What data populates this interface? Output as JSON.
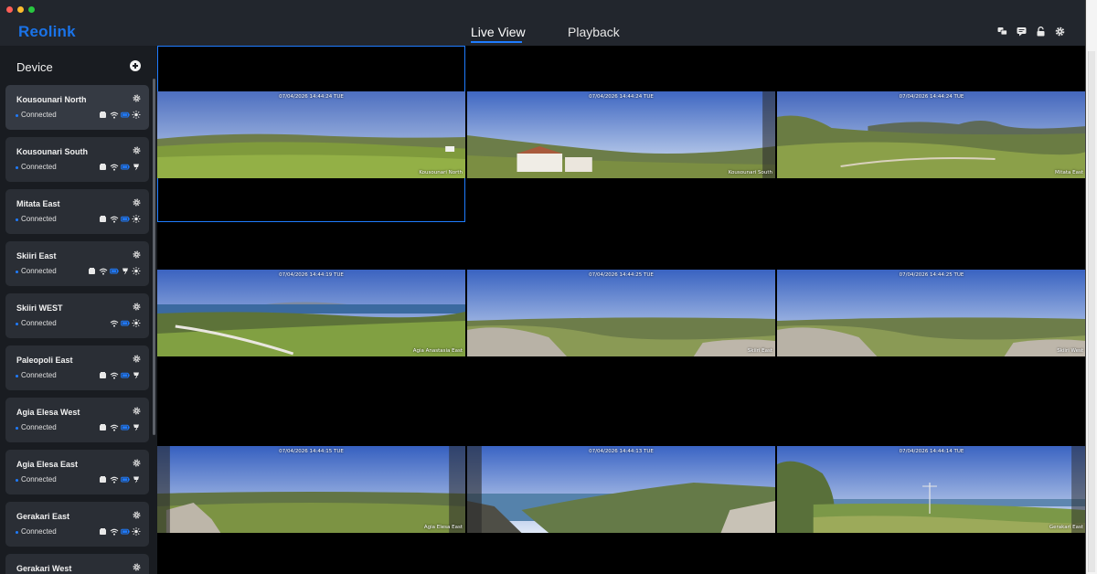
{
  "app": {
    "logo": "Reolink",
    "tabs": [
      {
        "label": "Live View",
        "active": true
      },
      {
        "label": "Playback",
        "active": false
      }
    ],
    "header_icons": [
      "messages-icon",
      "chat-icon",
      "lock-icon",
      "gear-icon"
    ],
    "accent_color": "#1f7cff"
  },
  "sidebar": {
    "title": "Device",
    "add_icon": "add-circle-icon",
    "devices": [
      {
        "name": "Kousounari North",
        "status": "Connected",
        "icons": [
          "storage-icon",
          "wifi-icon",
          "battery-icon",
          "sun-icon"
        ]
      },
      {
        "name": "Kousounari South",
        "status": "Connected",
        "icons": [
          "storage-icon",
          "wifi-icon",
          "battery-icon",
          "solar-charging-icon"
        ]
      },
      {
        "name": "Mitata East",
        "status": "Connected",
        "icons": [
          "storage-icon",
          "wifi-icon",
          "battery-icon",
          "sun-icon"
        ]
      },
      {
        "name": "Skiiri East",
        "status": "Connected",
        "icons": [
          "storage-icon",
          "wifi-icon",
          "battery-icon",
          "solar-charging-icon",
          "sun-icon"
        ]
      },
      {
        "name": "Skiiri WEST",
        "status": "Connected",
        "icons": [
          "wifi-icon",
          "battery-icon",
          "sun-icon"
        ]
      },
      {
        "name": "Paleopoli East",
        "status": "Connected",
        "icons": [
          "storage-icon",
          "wifi-icon",
          "battery-icon",
          "solar-charging-icon"
        ]
      },
      {
        "name": "Agia Elesa West",
        "status": "Connected",
        "icons": [
          "storage-icon",
          "wifi-icon",
          "battery-icon",
          "solar-charging-icon"
        ]
      },
      {
        "name": "Agia Elesa East",
        "status": "Connected",
        "icons": [
          "storage-icon",
          "wifi-icon",
          "battery-icon",
          "solar-charging-icon"
        ]
      },
      {
        "name": "Gerakari East",
        "status": "Connected",
        "icons": [
          "storage-icon",
          "wifi-icon",
          "battery-icon",
          "sun-icon"
        ]
      },
      {
        "name": "Gerakari West",
        "status": "",
        "icons": []
      }
    ]
  },
  "cameras": [
    {
      "timestamp": "07/04/2026 14:44:24 TUE",
      "label": "Kousounari North",
      "selected": true,
      "scene": "meadow"
    },
    {
      "timestamp": "07/04/2026 14:44:24 TUE",
      "label": "Kousounari South",
      "selected": false,
      "scene": "village"
    },
    {
      "timestamp": "07/04/2026 14:44:24 TUE",
      "label": "Mitata East",
      "selected": false,
      "scene": "valley"
    },
    {
      "timestamp": "07/04/2026 14:44:19 TUE",
      "label": "Agia Anastasia East",
      "selected": false,
      "scene": "coast"
    },
    {
      "timestamp": "07/04/2026 14:44:25 TUE",
      "label": "Skiiri East",
      "selected": false,
      "scene": "rocky"
    },
    {
      "timestamp": "07/04/2026 14:44:25 TUE",
      "label": "Skiiri West",
      "selected": false,
      "scene": "rocky"
    },
    {
      "timestamp": "07/04/2026 14:44:15 TUE",
      "label": "Agia Elesa East",
      "selected": false,
      "scene": "cliff"
    },
    {
      "timestamp": "07/04/2026 14:44:13 TUE",
      "label": "",
      "selected": false,
      "scene": "bay"
    },
    {
      "timestamp": "07/04/2026 14:44:14 TUE",
      "label": "Gerakari East",
      "selected": false,
      "scene": "trees"
    }
  ]
}
